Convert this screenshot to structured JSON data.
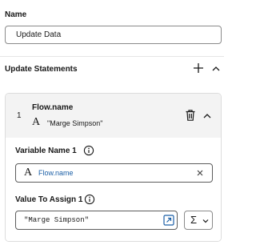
{
  "name_section": {
    "label": "Name",
    "value": "Update Data"
  },
  "update_section": {
    "label": "Update Statements",
    "add_icon": "plus-icon",
    "collapse_icon": "chevron-up-icon"
  },
  "statement": {
    "index": "1",
    "title": "Flow.name",
    "type_glyph": "A",
    "subtitle": "\"Marge Simpson\"",
    "delete_icon": "trash-icon",
    "collapse_icon": "chevron-up-icon",
    "variable_label": "Variable Name 1",
    "variable_glyph": "A",
    "variable_value": "Flow.name",
    "value_label": "Value To Assign 1",
    "value_text": "\"Marge Simpson\"",
    "expression_glyph": "Σ"
  },
  "colors": {
    "link_blue": "#1b5fa6",
    "card_header_bg": "#f3f3f3",
    "border": "#dcdcdc"
  }
}
